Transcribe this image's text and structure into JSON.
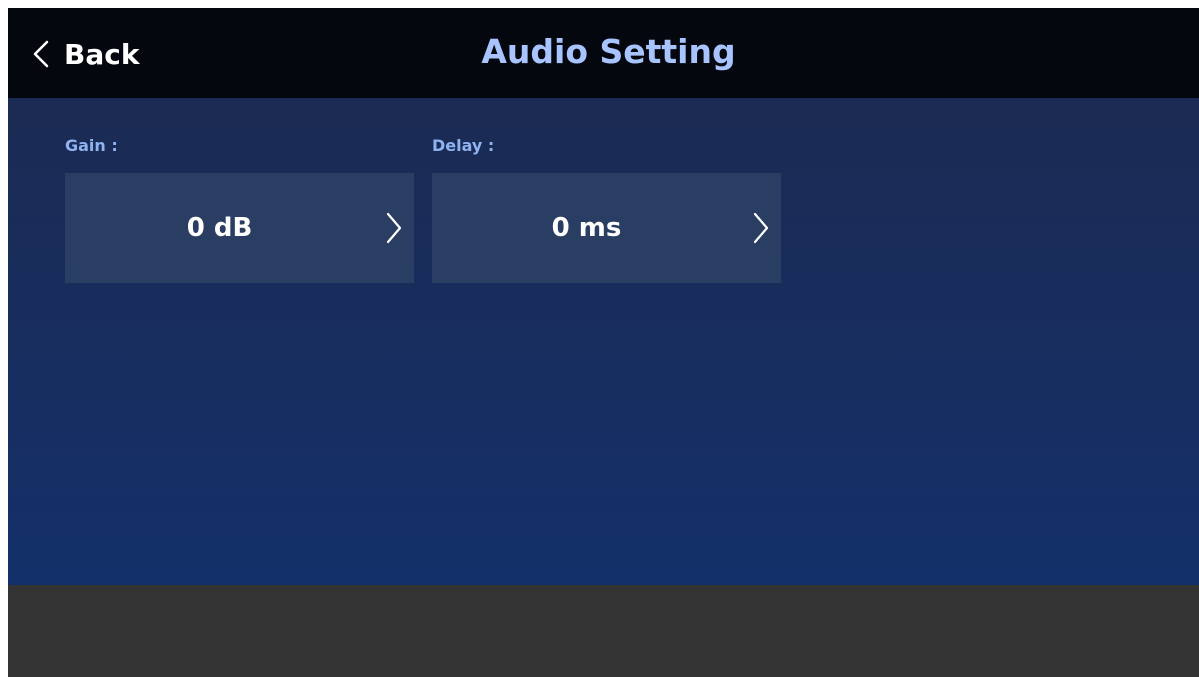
{
  "header": {
    "back_label": "Back",
    "title": "Audio Setting"
  },
  "fields": {
    "gain": {
      "label": "Gain :",
      "value": "0 dB"
    },
    "delay": {
      "label": "Delay :",
      "value": "0 ms"
    }
  },
  "icons": {
    "back": "chevron-left-icon",
    "field_arrow": "chevron-right-icon"
  },
  "colors": {
    "header_bg": "#05070f",
    "title": "#a8c4ff",
    "label": "#8fb2f0",
    "panel_top": "#1b2b53",
    "panel_bottom": "#14306a",
    "field_bg": "#2a3d62",
    "footer_bg": "#333333"
  }
}
